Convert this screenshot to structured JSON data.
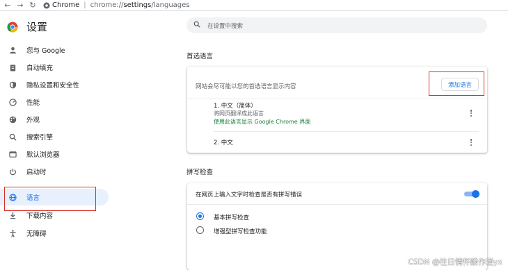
{
  "browser": {
    "back_glyph": "←",
    "forward_glyph": "→",
    "reload_glyph": "↻",
    "site_name": "Chrome",
    "url_prefix": "chrome://",
    "url_path": "settings",
    "url_suffix": "/languages"
  },
  "sidebar": {
    "title": "设置",
    "items": [
      {
        "label": "您与 Google",
        "icon": "person-icon"
      },
      {
        "label": "自动填充",
        "icon": "clipboard-icon"
      },
      {
        "label": "隐私设置和安全性",
        "icon": "shield-icon"
      },
      {
        "label": "性能",
        "icon": "speedometer-icon"
      },
      {
        "label": "外观",
        "icon": "palette-icon"
      },
      {
        "label": "搜索引擎",
        "icon": "search-icon"
      },
      {
        "label": "默认浏览器",
        "icon": "browser-icon"
      },
      {
        "label": "启动时",
        "icon": "power-icon"
      },
      {
        "label": "语言",
        "icon": "globe-icon",
        "active": true
      },
      {
        "label": "下载内容",
        "icon": "download-icon"
      },
      {
        "label": "无障碍",
        "icon": "accessibility-icon"
      }
    ]
  },
  "search": {
    "placeholder": "在设置中搜索"
  },
  "preferred_languages": {
    "title": "首选语言",
    "description": "网站会尽可能以您的首选语言显示内容",
    "add_button": "添加语言",
    "languages": [
      {
        "name": "1. 中文（简体）",
        "sub": "将网页翻译成此语言",
        "link": "使用此语言显示 Google Chrome 界面"
      },
      {
        "name": "2. 中文"
      }
    ]
  },
  "spellcheck": {
    "title": "拼写检查",
    "toggle_label": "在网页上输入文字时检查是否有拼写错误",
    "toggle_on": true,
    "options": [
      {
        "label": "基本拼写检查",
        "selected": true
      },
      {
        "label": "增强型拼写检查功能",
        "selected": false
      }
    ]
  },
  "watermark": "CSDN @往日情怀酿作酒yx",
  "colors": {
    "accent": "#1a73e8",
    "highlight": "#d93025",
    "link_green": "#188038"
  }
}
